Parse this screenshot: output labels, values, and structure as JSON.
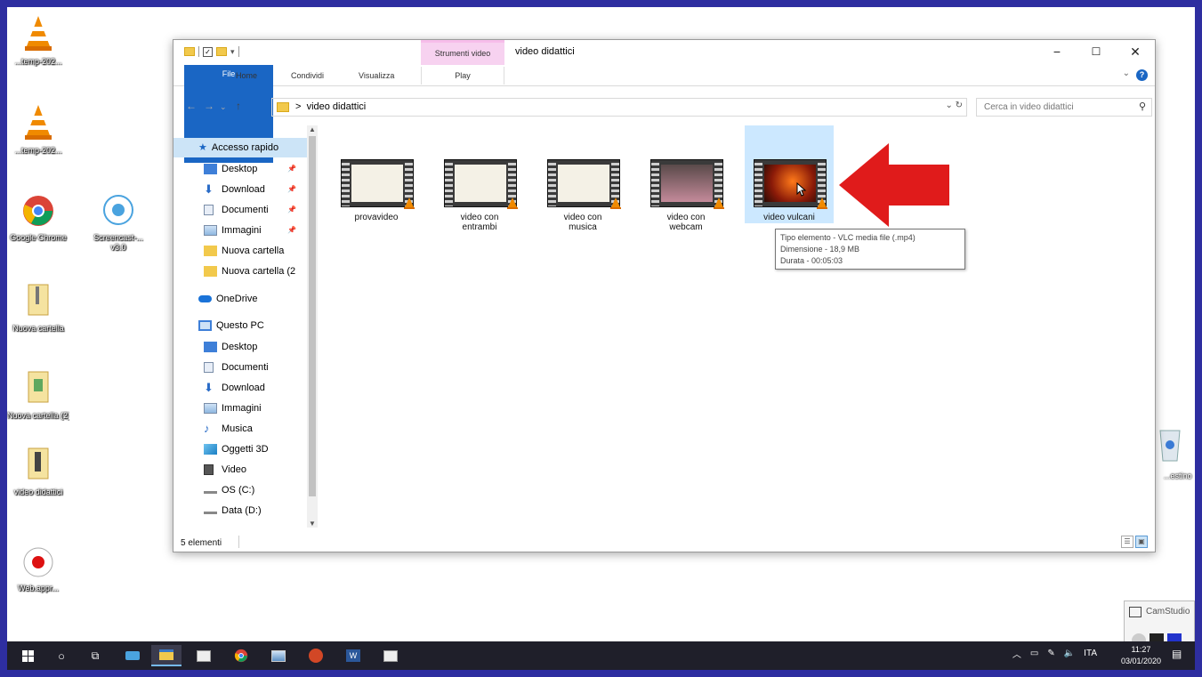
{
  "window": {
    "title": "video didattici",
    "context_tab_group": "Strumenti video",
    "ribbon_tabs": [
      "File",
      "Home",
      "Condividi",
      "Visualizza",
      "Play"
    ],
    "minimize": "−",
    "maximize": "☐",
    "close": "✕"
  },
  "address": {
    "path_separator": ">",
    "path": "video didattici",
    "search_placeholder": "Cerca in video didattici"
  },
  "nav": {
    "quick_access": "Accesso rapido",
    "quick_items": [
      "Desktop",
      "Download",
      "Documenti",
      "Immagini",
      "Nuova cartella",
      "Nuova cartella (2"
    ],
    "onedrive": "OneDrive",
    "this_pc": "Questo PC",
    "pc_items": [
      "Desktop",
      "Documenti",
      "Download",
      "Immagini",
      "Musica",
      "Oggetti 3D",
      "Video",
      "OS (C:)",
      "Data (D:)"
    ]
  },
  "files": [
    {
      "name": "provavideo"
    },
    {
      "name": "video con\nentrambi"
    },
    {
      "name": "video con\nmusica"
    },
    {
      "name": "video con\nwebcam"
    },
    {
      "name": "video vulcani"
    }
  ],
  "tooltip": {
    "line1": "Tipo elemento - VLC media file (.mp4)",
    "line2": "Dimensione - 18,9 MB",
    "line3": "Durata - 00:05:03"
  },
  "status": {
    "count": "5 elementi"
  },
  "desktop": {
    "icons": [
      "...temp-202...",
      "...temp-202...",
      "Google Chrome",
      "Screencast-...\nv3.0",
      "Nuova cartella",
      "Nuova cartella (2)",
      "video didattici",
      "Web.appr..."
    ],
    "recycle_label": "...estino"
  },
  "camstudio": {
    "title": "CamStudio"
  },
  "taskbar": {
    "lang": "ITA",
    "time": "11:27",
    "date": "03/01/2020"
  },
  "colors": {
    "accent": "#1a66c4",
    "selection": "#cce8ff",
    "arrow": "#e01b1b",
    "context_tab": "#f7d2f0"
  }
}
